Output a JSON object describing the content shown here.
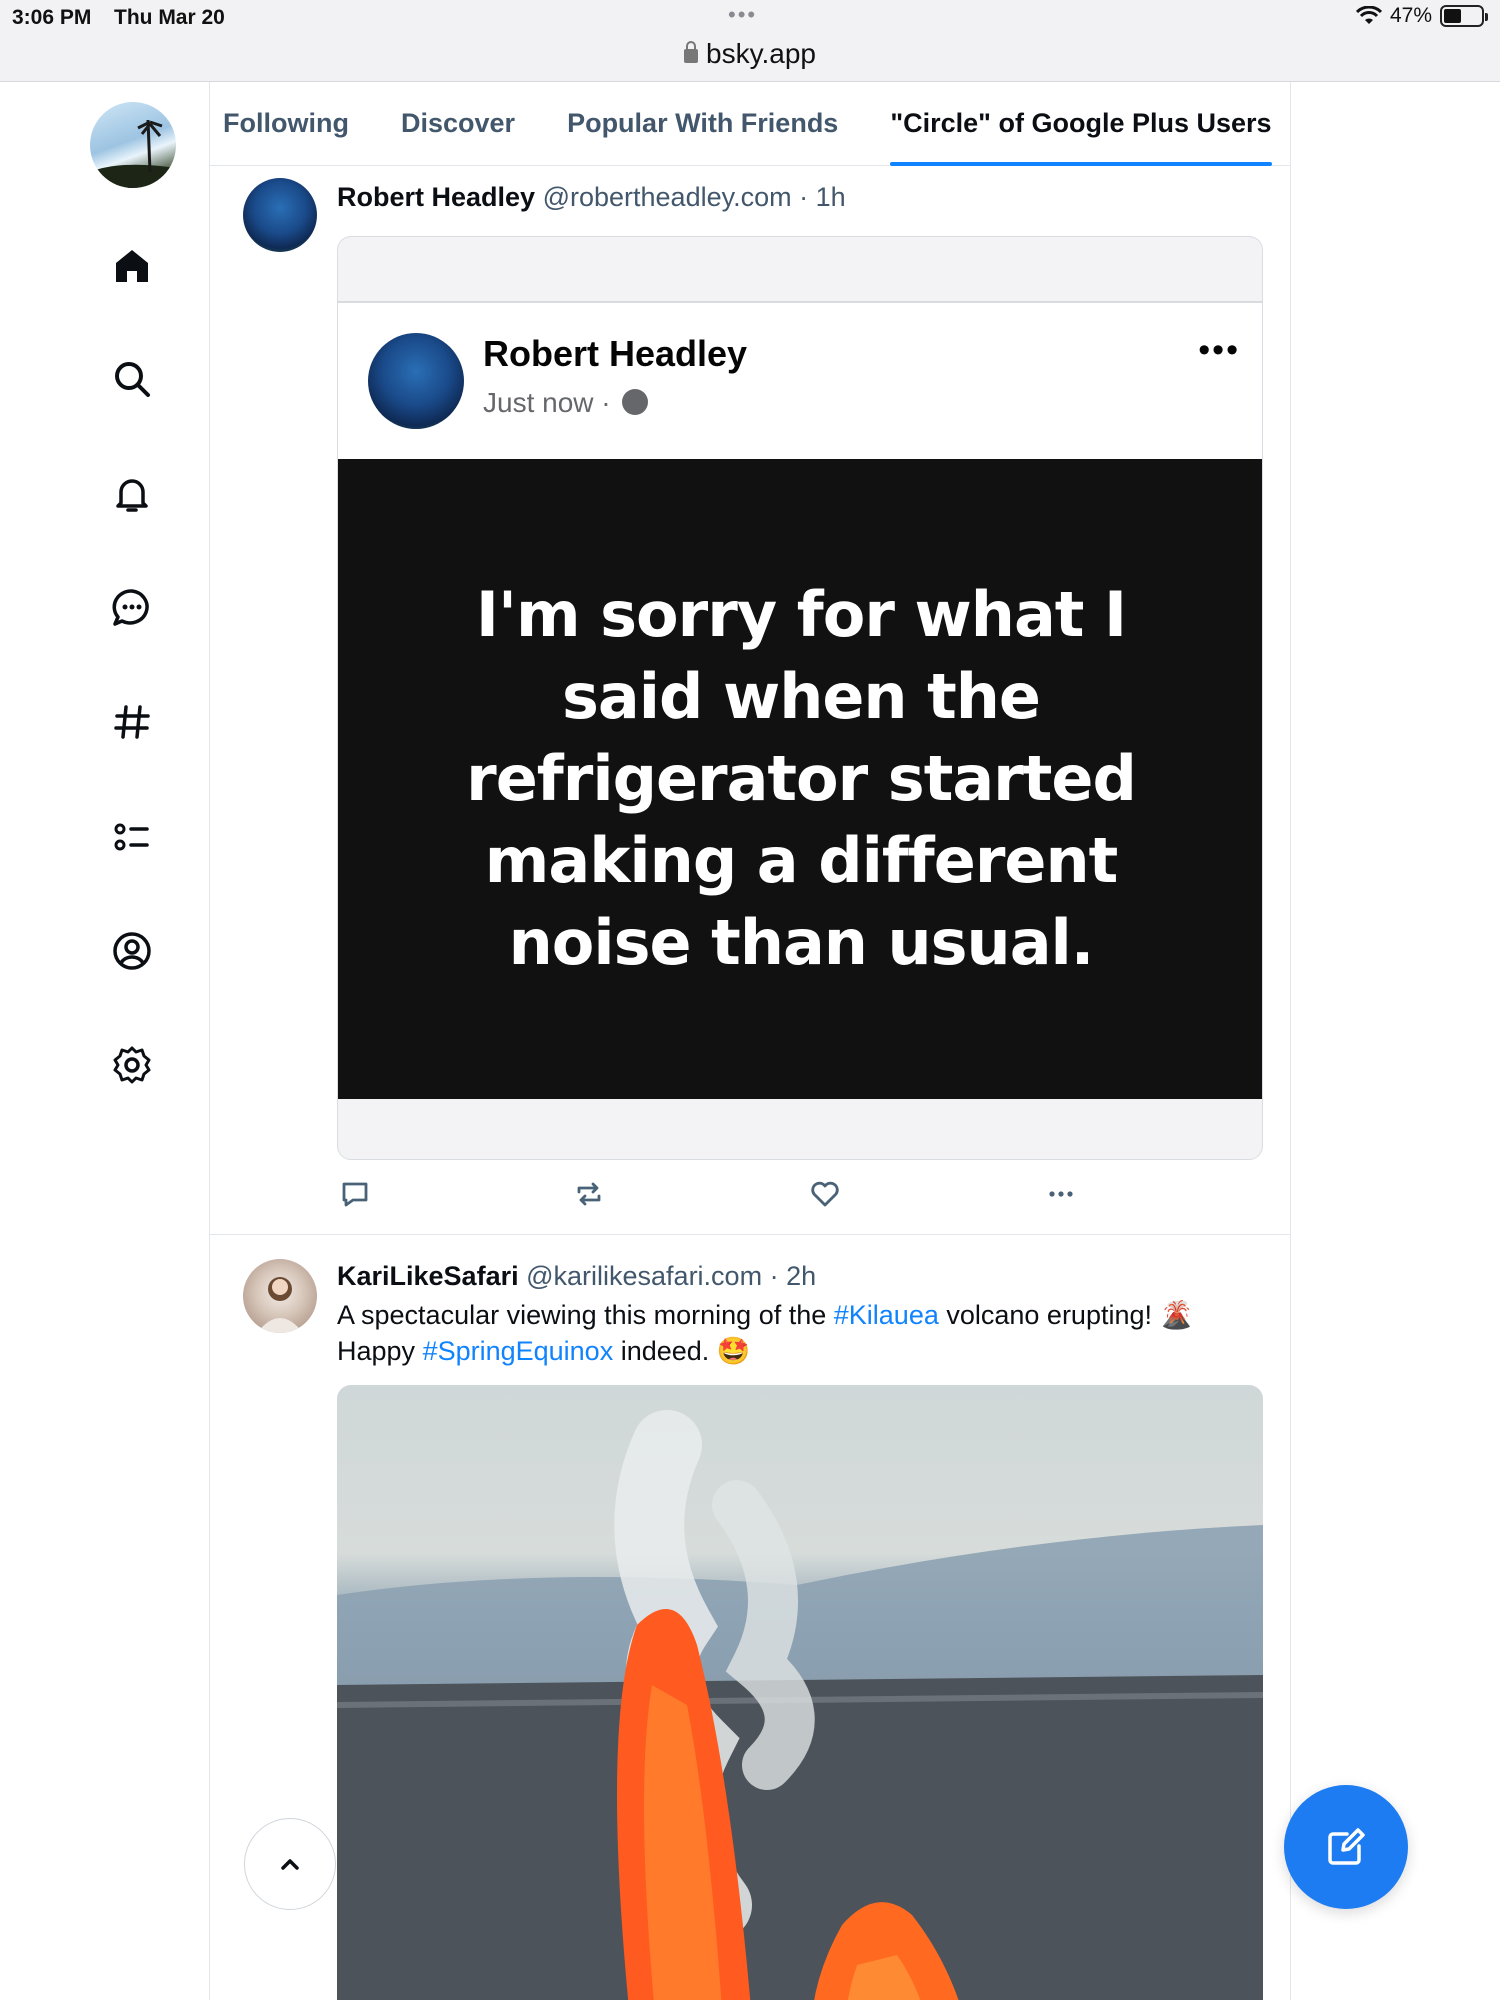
{
  "status_bar": {
    "time": "3:06 PM",
    "date": "Thu Mar 20",
    "url": "bsky.app",
    "battery": "47%",
    "battery_level": 0.47
  },
  "sidebar": {
    "items": [
      {
        "icon": "home-icon"
      },
      {
        "icon": "search-icon"
      },
      {
        "icon": "bell-icon"
      },
      {
        "icon": "chat-icon"
      },
      {
        "icon": "hashtag-icon"
      },
      {
        "icon": "list-icon"
      },
      {
        "icon": "profile-icon"
      },
      {
        "icon": "gear-icon"
      }
    ]
  },
  "tabs": [
    {
      "label": "Following",
      "active": false
    },
    {
      "label": "Discover",
      "active": false
    },
    {
      "label": "Popular With Friends",
      "active": false
    },
    {
      "label": "\"Circle\" of Google Plus Users",
      "active": true
    }
  ],
  "posts": [
    {
      "name": "Robert Headley",
      "handle": "@robertheadley.com",
      "time": "1h",
      "embed": {
        "author": "Robert Headley",
        "time": "Just now",
        "more": "•••",
        "quote": "I'm sorry for what I said when the refrigerator started making a different noise than usual."
      },
      "actions": [
        "reply-icon",
        "repost-icon",
        "like-icon",
        "more-icon"
      ]
    },
    {
      "name": "KariLikeSafari",
      "handle": "@karilikesafari.com",
      "time": "2h",
      "text_parts": [
        {
          "text": "A spectacular viewing this morning of the ",
          "tag": false
        },
        {
          "text": "#Kilauea",
          "tag": true
        },
        {
          "text": " volcano erupting! 🌋",
          "tag": false
        },
        {
          "text": "Happy ",
          "tag": false
        },
        {
          "text": "#SpringEquinox",
          "tag": true
        },
        {
          "text": " indeed. 🤩",
          "tag": false
        }
      ]
    }
  ],
  "colors": {
    "accent": "#1083fe",
    "compose_button": "#1d7cf2",
    "secondary_text": "#42576c"
  }
}
